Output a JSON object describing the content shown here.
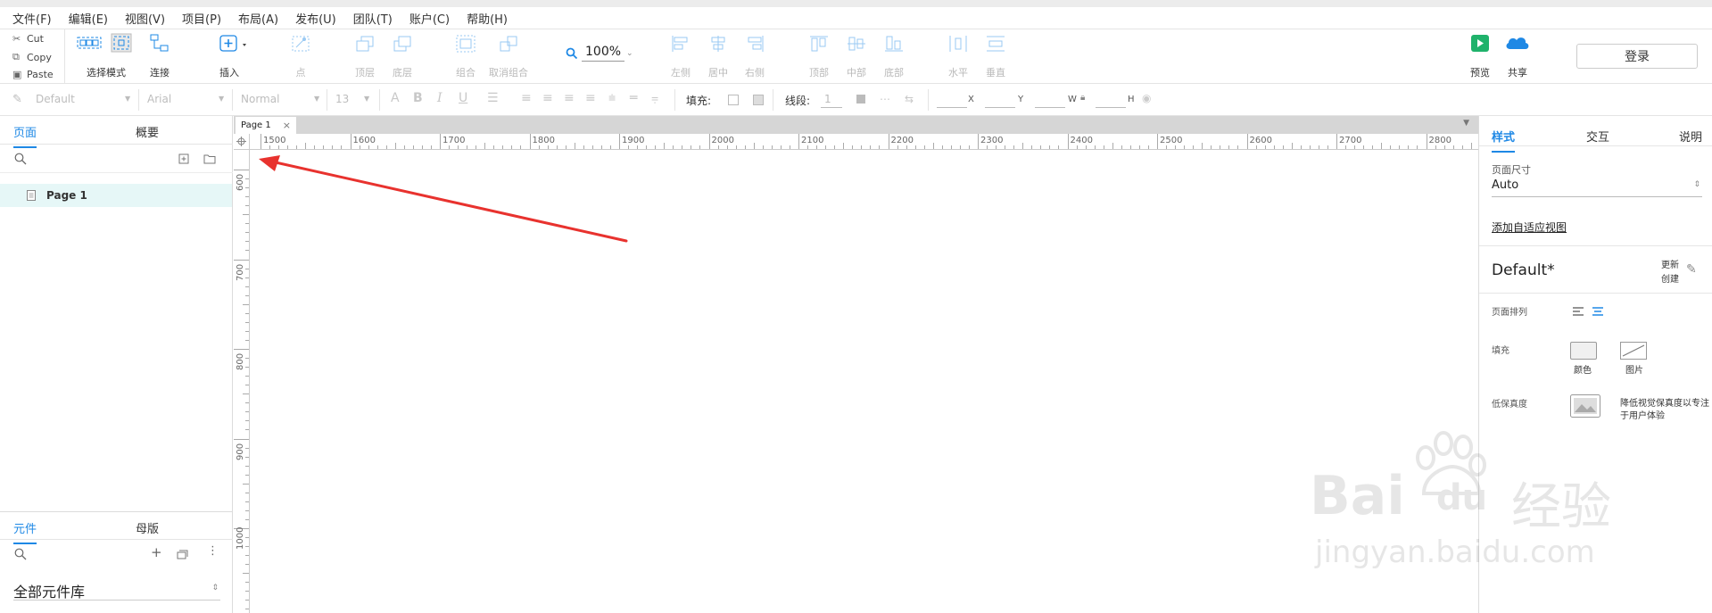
{
  "menu": [
    "文件(F)",
    "编辑(E)",
    "视图(V)",
    "项目(P)",
    "布局(A)",
    "发布(U)",
    "团队(T)",
    "账户(C)",
    "帮助(H)"
  ],
  "clipboard": {
    "cut": "Cut",
    "copy": "Copy",
    "paste": "Paste"
  },
  "toolbar": {
    "select_mode": "选择模式",
    "connect": "连接",
    "insert": "插入",
    "point": "点",
    "top_layer": "顶层",
    "bottom_layer": "底层",
    "group": "组合",
    "ungroup": "取消组合",
    "zoom": "100%",
    "left": "左侧",
    "center": "居中",
    "right": "右侧",
    "top": "顶部",
    "middle": "中部",
    "bottom": "底部",
    "horizontal": "水平",
    "vertical": "垂直",
    "preview": "预览",
    "share": "共享",
    "login": "登录"
  },
  "format": {
    "style": "Default",
    "font": "Arial",
    "weight": "Normal",
    "size": "13",
    "fill_label": "填充:",
    "line_label": "线段:",
    "line_width": "1",
    "x_label": "X",
    "y_label": "Y",
    "w_label": "W",
    "h_label": "H"
  },
  "left": {
    "tab_pages": "页面",
    "tab_outline": "概要",
    "page_item": "Page 1",
    "tab_widgets": "元件",
    "tab_masters": "母版",
    "library": "全部元件库"
  },
  "canvas": {
    "tab": "Page 1",
    "hruler": [
      "1500",
      "1600",
      "1700",
      "1800",
      "1900",
      "2000",
      "2100",
      "2200",
      "2300",
      "2400",
      "2500",
      "2600",
      "2700",
      "2800"
    ],
    "vruler": [
      "600",
      "700",
      "800",
      "900",
      "1000"
    ]
  },
  "right": {
    "tab_style": "样式",
    "tab_interaction": "交互",
    "tab_notes": "说明",
    "page_size_label": "页面尺寸",
    "page_size_value": "Auto",
    "add_adaptive": "添加自适应视图",
    "style_name": "Default*",
    "update_label": "更新",
    "create_label": "创建",
    "page_align_label": "页面排列",
    "fill_label": "填充",
    "fill_color": "颜色",
    "fill_image": "图片",
    "low_fidelity_label": "低保真度",
    "low_fidelity_desc_1": "降低视觉保真度以专注",
    "low_fidelity_desc_2": "于用户体验"
  },
  "watermark": {
    "brand": "Bai",
    "brand2": "du",
    "cn": "经验",
    "url": "jingyan.baidu.com"
  },
  "colors": {
    "accent": "#1e88e5",
    "selected_row": "#e6f7f7",
    "arrow": "#e8322e",
    "preview_green": "#1fb26b"
  }
}
